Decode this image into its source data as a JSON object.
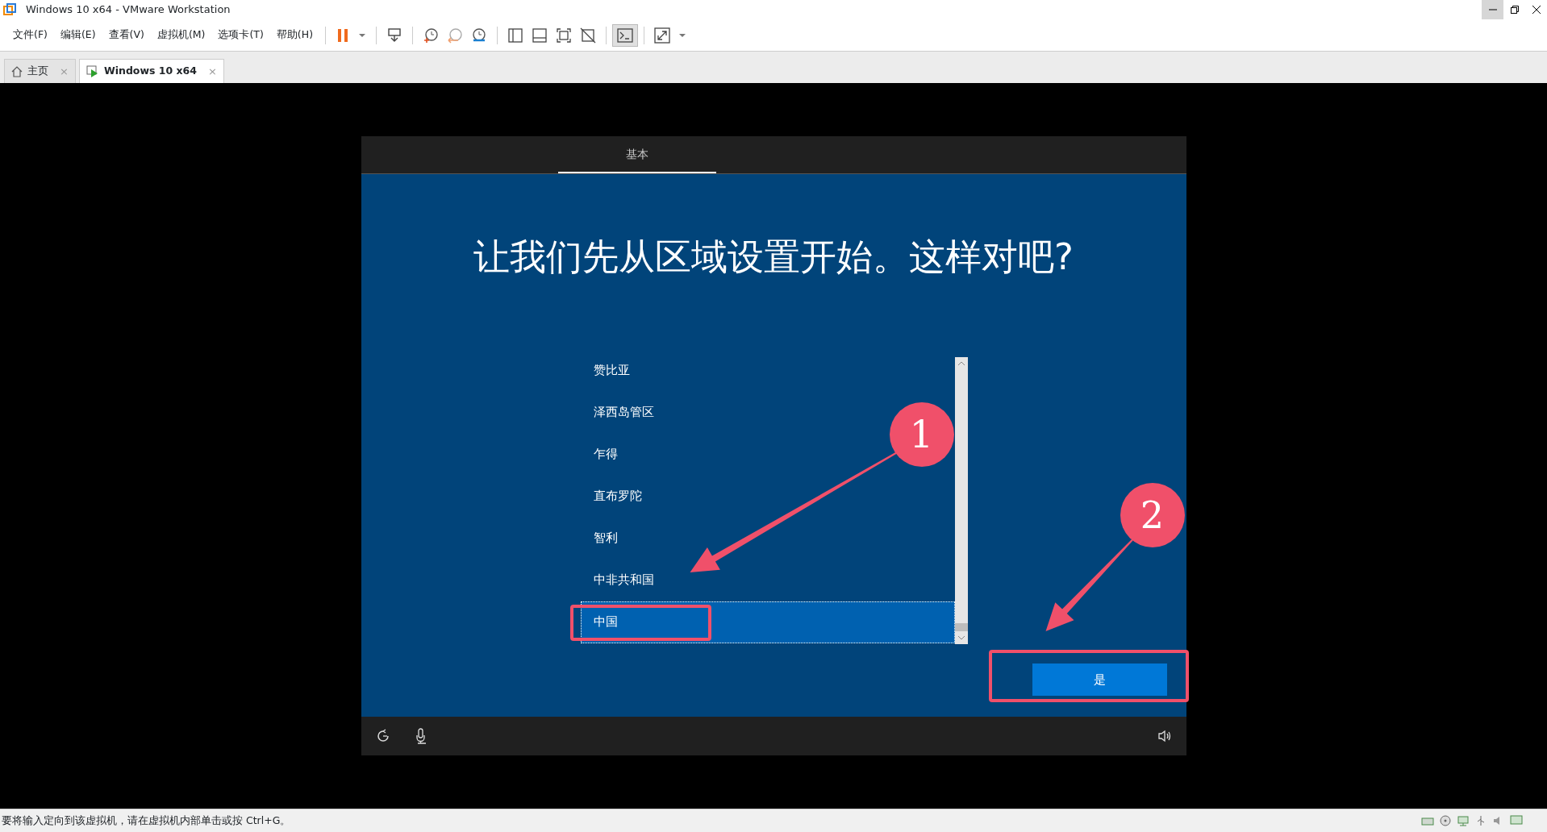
{
  "window": {
    "title": "Windows 10 x64 - VMware Workstation"
  },
  "menu": [
    "文件(F)",
    "编辑(E)",
    "查看(V)",
    "虚拟机(M)",
    "选项卡(T)",
    "帮助(H)"
  ],
  "tabs": [
    {
      "label": "主页",
      "selected": false,
      "kind": "home",
      "close": "×"
    },
    {
      "label": "Windows 10 x64",
      "selected": true,
      "kind": "vm",
      "close": "×"
    }
  ],
  "vm_screen": {
    "header_tab": "基本",
    "heading": "让我们先从区域设置开始。这样对吧?",
    "regions": [
      {
        "label": "赞比亚",
        "selected": false
      },
      {
        "label": "泽西岛管区",
        "selected": false
      },
      {
        "label": "乍得",
        "selected": false
      },
      {
        "label": "直布罗陀",
        "selected": false
      },
      {
        "label": "智利",
        "selected": false
      },
      {
        "label": "中非共和国",
        "selected": false
      },
      {
        "label": "中国",
        "selected": true
      }
    ],
    "confirm_button": "是"
  },
  "annotations": [
    {
      "number": "1",
      "kind": "list"
    },
    {
      "number": "2",
      "kind": "button"
    }
  ],
  "status_bar": "要将输入定向到该虚拟机，请在虚拟机内部单击或按 Ctrl+G。"
}
